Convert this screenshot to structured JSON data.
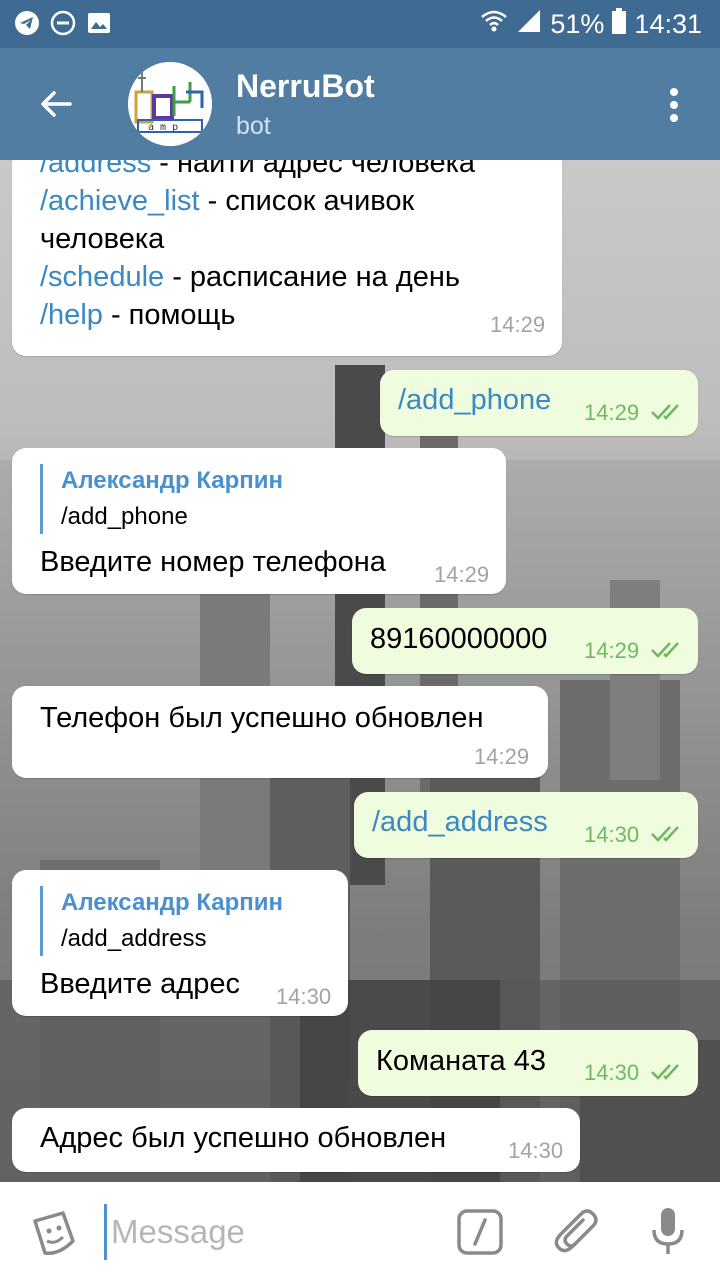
{
  "status_bar": {
    "battery": "51%",
    "time": "14:31"
  },
  "header": {
    "title": "NerruBot",
    "subtitle": "bot"
  },
  "messages": [
    {
      "lines": [
        {
          "cmd": "/address",
          "text": " - найти адрес человека"
        },
        {
          "cmd": "/achieve_list",
          "text": " - список ачивок"
        },
        {
          "cmd": "",
          "text": "человека"
        },
        {
          "cmd": "/schedule",
          "text": " - расписание на день"
        },
        {
          "cmd": "/help",
          "text": " - помощь"
        }
      ],
      "time": "14:29"
    },
    {
      "text": "/add_phone",
      "time": "14:29"
    },
    {
      "quote_name": "Александр Карпин",
      "quote_text": "/add_phone",
      "text": "Введите номер телефона",
      "time": "14:29"
    },
    {
      "text": "89160000000",
      "time": "14:29"
    },
    {
      "text": "Телефон был успешно обновлен",
      "time": "14:29"
    },
    {
      "text": "/add_address",
      "time": "14:30"
    },
    {
      "quote_name": "Александр Карпин",
      "quote_text": "/add_address",
      "text": "Введите адрес",
      "time": "14:30"
    },
    {
      "text": "Команата 43",
      "time": "14:30"
    },
    {
      "text": "Адрес был успешно обновлен",
      "time": "14:30"
    }
  ],
  "input": {
    "placeholder": "Message"
  },
  "icons": {
    "status_left": [
      "telegram-icon",
      "do-not-disturb-icon",
      "image-icon"
    ],
    "status_right": [
      "wifi-icon",
      "signal-icon",
      "battery-icon"
    ],
    "header": [
      "back-arrow-icon",
      "more-vert-icon"
    ],
    "input_bar": [
      "sticker-icon",
      "bot-command-icon",
      "attach-icon",
      "microphone-icon"
    ]
  },
  "colors": {
    "header_bg": "#517da2",
    "status_bg": "#3f6a92",
    "outgoing_bubble": "#effdde",
    "incoming_bubble": "#ffffff",
    "command_link": "#3a88c4",
    "read_ticks": "#6fb962"
  }
}
